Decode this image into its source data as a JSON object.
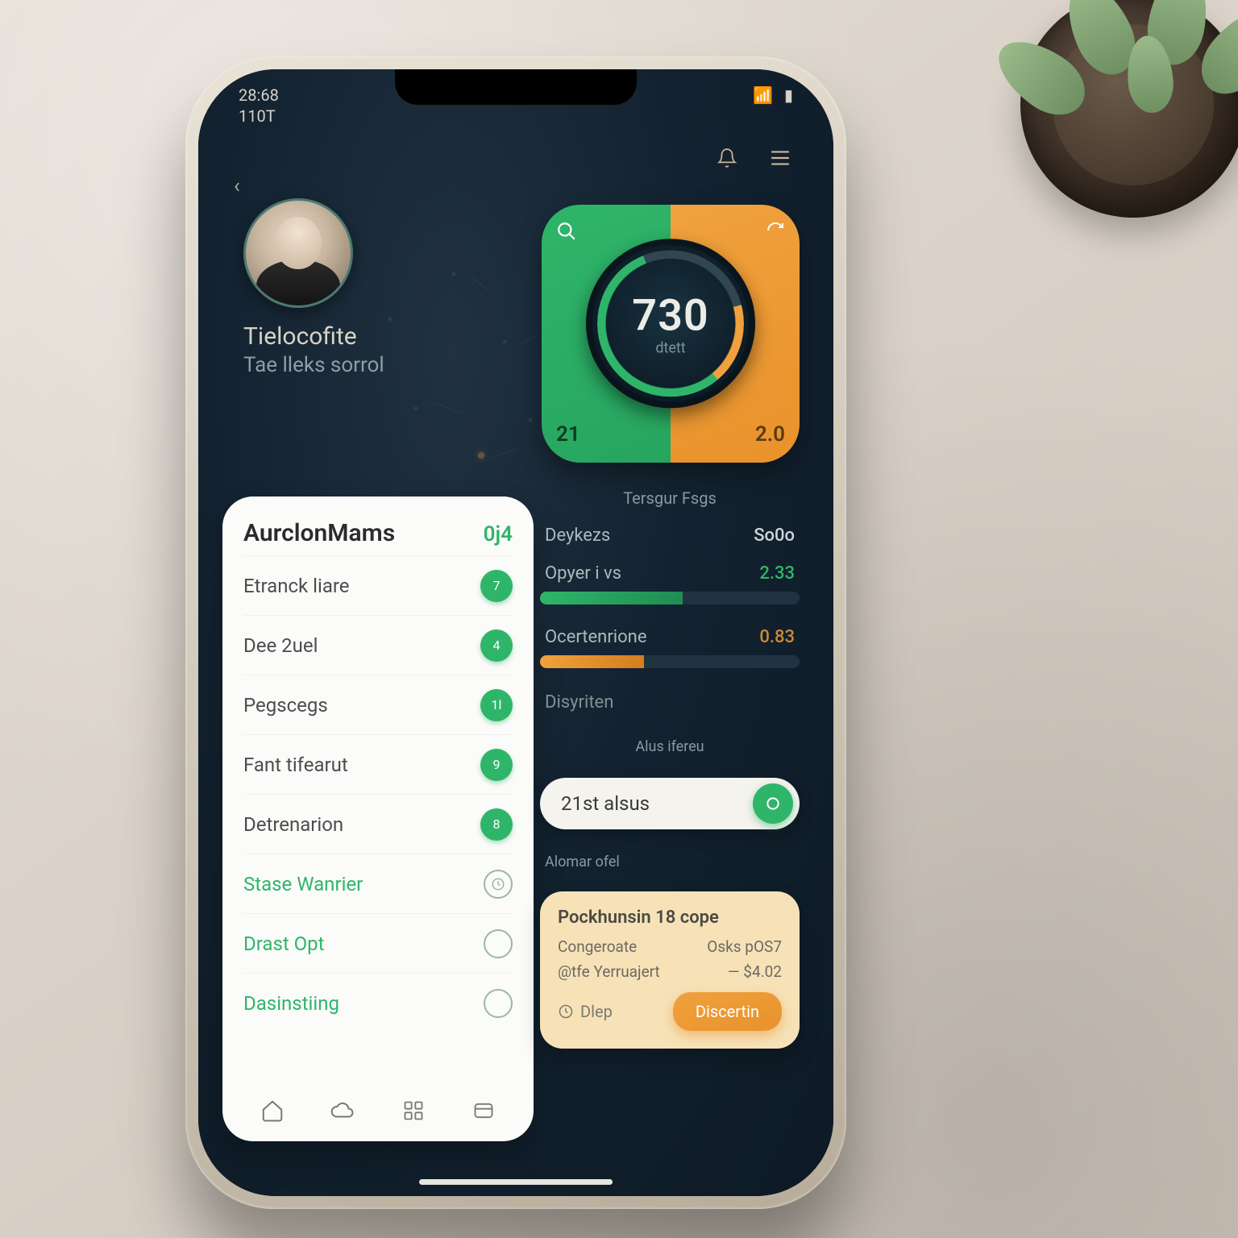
{
  "colors": {
    "green": "#2fb56a",
    "orange": "#f0a13d",
    "ink": "#132230",
    "cream": "#f7e2b8"
  },
  "status": {
    "line1": "28:68",
    "line2": "110T",
    "wifi": "•",
    "battery": "≡"
  },
  "profile": {
    "name": "Tielocofite",
    "subtitle": "Tae lleks sorrol"
  },
  "gauge": {
    "value": "730",
    "unit": "dtett",
    "left": "21",
    "right": "2.0",
    "search_icon": "search",
    "refresh_icon": "refresh"
  },
  "leftcard": {
    "title": "AurclonMams",
    "badge": "0j4",
    "items": [
      {
        "label": "Etranck liare",
        "chip": "7",
        "type": "chip"
      },
      {
        "label": "Dee 2uel",
        "chip": "4",
        "type": "chip"
      },
      {
        "label": "Pegscegs",
        "chip": "1l",
        "type": "chip"
      },
      {
        "label": "Fant tifearut",
        "chip": "9",
        "type": "chip"
      },
      {
        "label": "Detrenarion",
        "chip": "8",
        "type": "chip"
      },
      {
        "label": "Stase Wanrier",
        "type": "iconring"
      },
      {
        "label": "Drast Opt",
        "type": "ring"
      },
      {
        "label": "Dasinstiing",
        "type": "ring"
      }
    ]
  },
  "tabbar": [
    "home",
    "cloud",
    "grid",
    "card"
  ],
  "rcol": {
    "heading": "Tersgur Fsgs",
    "row1": {
      "label": "Deykezs",
      "value": "So0o"
    },
    "row2": {
      "label": "Opyer i vs",
      "value": "2.33",
      "pct": 55
    },
    "row3": {
      "label": "Ocertenrione",
      "value": "0.83",
      "pct": 40
    },
    "row4": {
      "label": "Disyriten"
    },
    "pill_label_top": "Alus ifereu",
    "pill": "21st alsus",
    "mini": "Alomar ofel"
  },
  "cream": {
    "title": "Pockhunsin 18 cope",
    "rows": [
      {
        "l": "Congeroate",
        "r": "Osks pOS7"
      },
      {
        "l": "@tfe Yerruajert",
        "r": "— $4.02"
      }
    ],
    "ghost": "Dlep",
    "cta": "Discertin"
  }
}
